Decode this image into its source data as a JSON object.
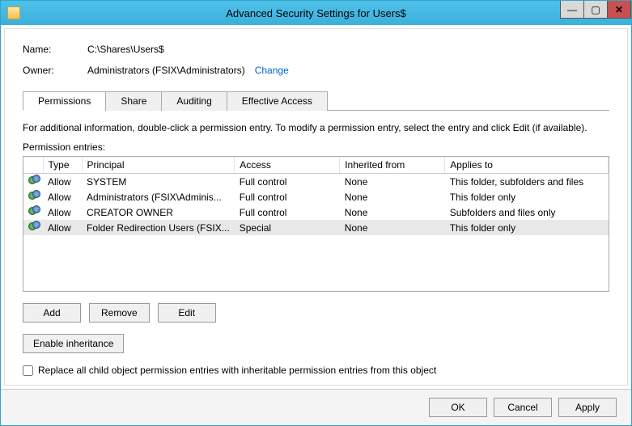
{
  "window": {
    "title": "Advanced Security Settings for Users$"
  },
  "info": {
    "name_label": "Name:",
    "name_value": "C:\\Shares\\Users$",
    "owner_label": "Owner:",
    "owner_value": "Administrators (FSIX\\Administrators)",
    "change_link": "Change"
  },
  "tabs": {
    "permissions": "Permissions",
    "share": "Share",
    "auditing": "Auditing",
    "effective": "Effective Access"
  },
  "text": {
    "info_line": "For additional information, double-click a permission entry. To modify a permission entry, select the entry and click Edit (if available).",
    "entries_label": "Permission entries:"
  },
  "columns": {
    "type": "Type",
    "principal": "Principal",
    "access": "Access",
    "inherited": "Inherited from",
    "applies": "Applies to"
  },
  "rows": [
    {
      "type": "Allow",
      "principal": "SYSTEM",
      "access": "Full control",
      "inherited": "None",
      "applies": "This folder, subfolders and files"
    },
    {
      "type": "Allow",
      "principal": "Administrators (FSIX\\Adminis...",
      "access": "Full control",
      "inherited": "None",
      "applies": "This folder only"
    },
    {
      "type": "Allow",
      "principal": "CREATOR OWNER",
      "access": "Full control",
      "inherited": "None",
      "applies": "Subfolders and files only"
    },
    {
      "type": "Allow",
      "principal": "Folder Redirection Users (FSIX...",
      "access": "Special",
      "inherited": "None",
      "applies": "This folder only"
    }
  ],
  "buttons": {
    "add": "Add",
    "remove": "Remove",
    "edit": "Edit",
    "enable_inheritance": "Enable inheritance",
    "ok": "OK",
    "cancel": "Cancel",
    "apply": "Apply"
  },
  "checkbox": {
    "replace_label": "Replace all child object permission entries with inheritable permission entries from this object"
  }
}
